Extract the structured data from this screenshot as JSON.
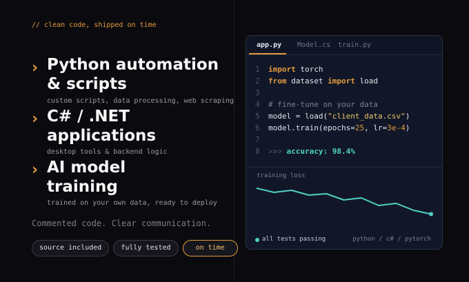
{
  "left": {
    "tagline": "// clean code, shipped on time",
    "features": [
      {
        "title_line1": "Python automation",
        "title_line2": "& scripts",
        "subtitle": "custom scripts, data processing, web scraping"
      },
      {
        "title_line1": "C# / .NET",
        "title_line2": "applications",
        "subtitle": "desktop tools & backend logic"
      },
      {
        "title_line1": "AI model",
        "title_line2": "training",
        "subtitle": "trained on your own data, ready to deploy"
      }
    ],
    "bullet": "›",
    "communication": "Commented code. Clear communication.",
    "badges": [
      "source included",
      "fully tested",
      "on time"
    ]
  },
  "editor": {
    "tabs": [
      "app.py",
      "Model.cs",
      "train.py"
    ],
    "active_tab": "app.py",
    "lines": [
      {
        "num": "1",
        "parts": [
          [
            "kw",
            "import"
          ],
          [
            "",
            " torch"
          ]
        ]
      },
      {
        "num": "2",
        "parts": [
          [
            "kw",
            "from"
          ],
          [
            "",
            " dataset "
          ],
          [
            "kw",
            "import"
          ],
          [
            "",
            " load"
          ]
        ]
      },
      {
        "num": "3",
        "parts": []
      },
      {
        "num": "4",
        "parts": [
          [
            "cm",
            "# fine-tune on your data"
          ]
        ]
      },
      {
        "num": "5",
        "parts": [
          [
            "",
            "model = load("
          ],
          [
            "str",
            "\"client_data.csv\""
          ],
          [
            "",
            ")"
          ]
        ]
      },
      {
        "num": "6",
        "parts": [
          [
            "",
            "model.train(epochs="
          ],
          [
            "num",
            "25"
          ],
          [
            "",
            ", lr="
          ],
          [
            "num",
            "3e-4"
          ],
          [
            "",
            ")"
          ]
        ]
      },
      {
        "num": "7",
        "parts": []
      },
      {
        "num": "8",
        "parts": [
          [
            "prompt",
            ">>> "
          ],
          [
            "acc",
            "accuracy: 98.4%"
          ]
        ]
      }
    ],
    "loss_label": "training loss",
    "loss_values": [
      0.9,
      0.78,
      0.84,
      0.7,
      0.74,
      0.56,
      0.62,
      0.4,
      0.46,
      0.26,
      0.15
    ],
    "status": "all tests passing",
    "stack": "python / c# / pytorch",
    "colors": {
      "accent": "#e49a3c",
      "teal": "#4fd1c5",
      "panel": "#111728"
    }
  }
}
